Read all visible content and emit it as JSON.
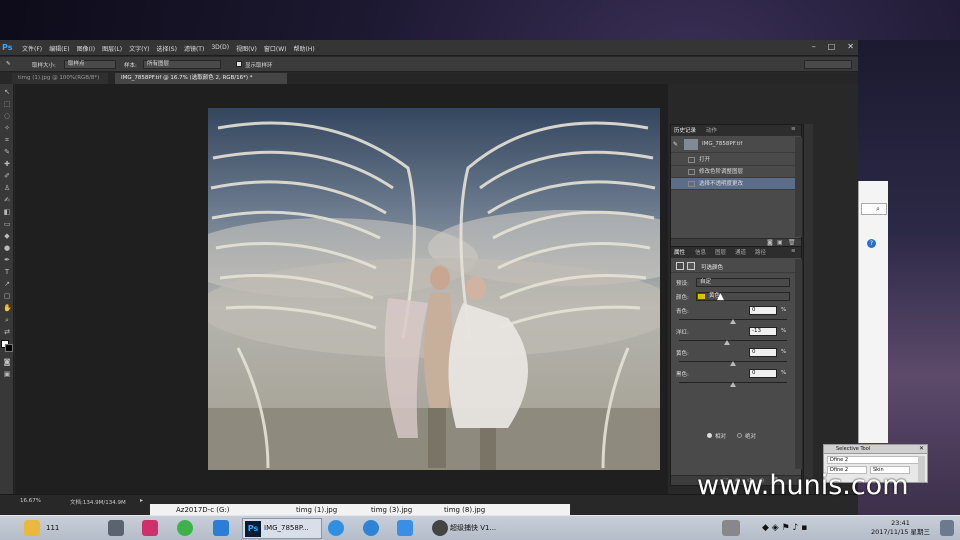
{
  "menu": [
    "文件(F)",
    "编辑(E)",
    "图像(I)",
    "图层(L)",
    "文字(Y)",
    "选择(S)",
    "滤镜(T)",
    "3D(D)",
    "视图(V)",
    "窗口(W)",
    "帮助(H)"
  ],
  "options": {
    "sample_size_label": "取样大小:",
    "sample_size_value": "取样点",
    "sample_label": "样本:",
    "sample_value": "所有图层",
    "show_ring_label": "显示取样环"
  },
  "tabs": [
    {
      "label": "timg (1).jpg @ 100%(RGB/8*)",
      "active": false
    },
    {
      "label": "IMG_7858PF.tif @ 16.7% (选取颜色 2, RGB/16*) *",
      "active": true
    }
  ],
  "history_panel": {
    "tabs": [
      "历史记录",
      "动作"
    ],
    "snapshot": "IMG_7858PF.tif",
    "items": [
      "打开",
      "修改色阶调整图层",
      "选择不透明度更改"
    ]
  },
  "properties_panel": {
    "tabs": [
      "属性",
      "信息",
      "图层",
      "通道",
      "路径"
    ],
    "title": "可选颜色",
    "preset_label": "预设:",
    "preset_value": "自定",
    "colors_label": "颜色:",
    "colors_value": "黄色",
    "colors_swatch": "#e0c000",
    "sliders": [
      {
        "label": "青色:",
        "value": "0",
        "unit": "%",
        "pos": 0.5
      },
      {
        "label": "洋红:",
        "value": "-13",
        "unit": "%",
        "pos": 0.44
      },
      {
        "label": "黄色:",
        "value": "0",
        "unit": "%",
        "pos": 0.5
      },
      {
        "label": "黑色:",
        "value": "0",
        "unit": "%",
        "pos": 0.5
      }
    ],
    "radio_relative": "相对",
    "radio_absolute": "绝对"
  },
  "status": {
    "zoom": "16.67%",
    "doc": "文档:134.9M/134.9M"
  },
  "sel_tool": {
    "title": "Selective Tool",
    "line1": "Dfine 2",
    "line2": "Dfine 2",
    "line3": "Skin"
  },
  "watermark": "www.hunis.com",
  "downloads": [
    "Az2017D-c (G:)",
    "timg (1).jpg",
    "timg (3).jpg",
    "timg (8).jpg"
  ],
  "taskbar": {
    "folder_label": "111",
    "ps_label": "IMG_7858P...",
    "app_label": "超级捕快 V1...",
    "time": "23:41",
    "date": "2017/11/15 星期三"
  }
}
